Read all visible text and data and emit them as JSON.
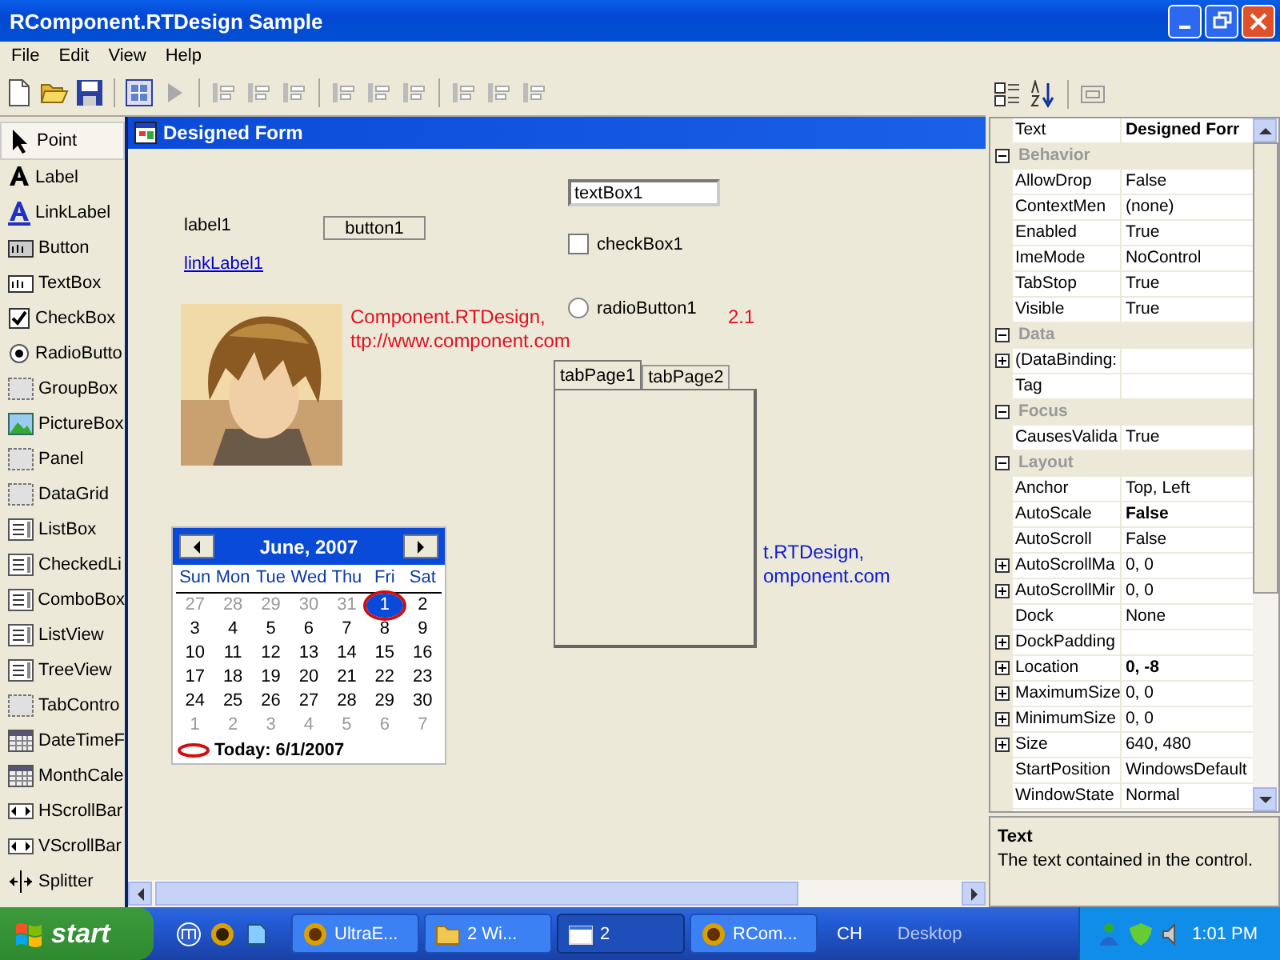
{
  "window": {
    "title": "RComponent.RTDesign Sample"
  },
  "menu": [
    "File",
    "Edit",
    "View",
    "Help"
  ],
  "toolbar": [
    {
      "kind": "new",
      "disabled": false
    },
    {
      "kind": "open",
      "disabled": false
    },
    {
      "kind": "save",
      "disabled": false
    },
    {
      "kind": "sep"
    },
    {
      "kind": "grid",
      "disabled": false
    },
    {
      "kind": "run",
      "disabled": true
    },
    {
      "kind": "sep"
    },
    {
      "kind": "align",
      "disabled": true
    },
    {
      "kind": "align",
      "disabled": true
    },
    {
      "kind": "align",
      "disabled": true
    },
    {
      "kind": "sep"
    },
    {
      "kind": "align",
      "disabled": true
    },
    {
      "kind": "align",
      "disabled": true
    },
    {
      "kind": "align",
      "disabled": true
    },
    {
      "kind": "sep"
    },
    {
      "kind": "align",
      "disabled": true
    },
    {
      "kind": "align",
      "disabled": true
    },
    {
      "kind": "align",
      "disabled": true
    }
  ],
  "toolbox": [
    {
      "label": "Point",
      "kind": "pointer",
      "selected": true
    },
    {
      "label": "Label",
      "kind": "label",
      "selected": false
    },
    {
      "label": "LinkLabel",
      "kind": "link",
      "selected": false
    },
    {
      "label": "Button",
      "kind": "button",
      "selected": false
    },
    {
      "label": "TextBox",
      "kind": "textbox",
      "selected": false
    },
    {
      "label": "CheckBox",
      "kind": "checkbox",
      "selected": false
    },
    {
      "label": "RadioButto",
      "kind": "radio",
      "selected": false
    },
    {
      "label": "GroupBox",
      "kind": "control",
      "selected": false
    },
    {
      "label": "PictureBox",
      "kind": "picture",
      "selected": false
    },
    {
      "label": "Panel",
      "kind": "control",
      "selected": false
    },
    {
      "label": "DataGrid",
      "kind": "control",
      "selected": false
    },
    {
      "label": "ListBox",
      "kind": "list",
      "selected": false
    },
    {
      "label": "CheckedLi",
      "kind": "list",
      "selected": false
    },
    {
      "label": "ComboBox",
      "kind": "list",
      "selected": false
    },
    {
      "label": "ListView",
      "kind": "list",
      "selected": false
    },
    {
      "label": "TreeView",
      "kind": "list",
      "selected": false
    },
    {
      "label": "TabContro",
      "kind": "control",
      "selected": false
    },
    {
      "label": "DateTimeF",
      "kind": "calendar",
      "selected": false
    },
    {
      "label": "MonthCale",
      "kind": "calendar",
      "selected": false
    },
    {
      "label": "HScrollBar",
      "kind": "scroll",
      "selected": false
    },
    {
      "label": "VScrollBar",
      "kind": "scroll",
      "selected": false
    },
    {
      "label": "Splitter",
      "kind": "splitter",
      "selected": false
    }
  ],
  "form": {
    "title": "Designed Form",
    "label": "label1",
    "button": "button1",
    "link": "linkLabel1",
    "textbox": {
      "value": "textBox1"
    },
    "checkbox": {
      "label": "checkBox1",
      "checked": false
    },
    "radio": {
      "label": "radioButton1",
      "checked": false
    },
    "red_text": [
      "Component.RTDesign, ",
      "2.1",
      "ttp://www.component.com"
    ],
    "blue_text": [
      "t.RTDesign,",
      "omponent.com"
    ],
    "tabs": [
      {
        "label": "tabPage1",
        "selected": true
      },
      {
        "label": "tabPage2",
        "selected": false
      }
    ],
    "calendar": {
      "month": "June, 2007",
      "days": [
        "Sun",
        "Mon",
        "Tue",
        "Wed",
        "Thu",
        "Fri",
        "Sat"
      ],
      "weeks": [
        [
          {
            "d": "27",
            "muted": true,
            "selected": false
          },
          {
            "d": "28",
            "muted": true,
            "selected": false
          },
          {
            "d": "29",
            "muted": true,
            "selected": false
          },
          {
            "d": "30",
            "muted": true,
            "selected": false
          },
          {
            "d": "31",
            "muted": true,
            "selected": false
          },
          {
            "d": "1",
            "muted": false,
            "selected": true
          },
          {
            "d": "2",
            "muted": false,
            "selected": false
          }
        ],
        [
          {
            "d": "3",
            "muted": false,
            "selected": false
          },
          {
            "d": "4",
            "muted": false,
            "selected": false
          },
          {
            "d": "5",
            "muted": false,
            "selected": false
          },
          {
            "d": "6",
            "muted": false,
            "selected": false
          },
          {
            "d": "7",
            "muted": false,
            "selected": false
          },
          {
            "d": "8",
            "muted": false,
            "selected": false
          },
          {
            "d": "9",
            "muted": false,
            "selected": false
          }
        ],
        [
          {
            "d": "10",
            "muted": false,
            "selected": false
          },
          {
            "d": "11",
            "muted": false,
            "selected": false
          },
          {
            "d": "12",
            "muted": false,
            "selected": false
          },
          {
            "d": "13",
            "muted": false,
            "selected": false
          },
          {
            "d": "14",
            "muted": false,
            "selected": false
          },
          {
            "d": "15",
            "muted": false,
            "selected": false
          },
          {
            "d": "16",
            "muted": false,
            "selected": false
          }
        ],
        [
          {
            "d": "17",
            "muted": false,
            "selected": false
          },
          {
            "d": "18",
            "muted": false,
            "selected": false
          },
          {
            "d": "19",
            "muted": false,
            "selected": false
          },
          {
            "d": "20",
            "muted": false,
            "selected": false
          },
          {
            "d": "21",
            "muted": false,
            "selected": false
          },
          {
            "d": "22",
            "muted": false,
            "selected": false
          },
          {
            "d": "23",
            "muted": false,
            "selected": false
          }
        ],
        [
          {
            "d": "24",
            "muted": false,
            "selected": false
          },
          {
            "d": "25",
            "muted": false,
            "selected": false
          },
          {
            "d": "26",
            "muted": false,
            "selected": false
          },
          {
            "d": "27",
            "muted": false,
            "selected": false
          },
          {
            "d": "28",
            "muted": false,
            "selected": false
          },
          {
            "d": "29",
            "muted": false,
            "selected": false
          },
          {
            "d": "30",
            "muted": false,
            "selected": false
          }
        ],
        [
          {
            "d": "1",
            "muted": true,
            "selected": false
          },
          {
            "d": "2",
            "muted": true,
            "selected": false
          },
          {
            "d": "3",
            "muted": true,
            "selected": false
          },
          {
            "d": "4",
            "muted": true,
            "selected": false
          },
          {
            "d": "5",
            "muted": true,
            "selected": false
          },
          {
            "d": "6",
            "muted": true,
            "selected": false
          },
          {
            "d": "7",
            "muted": true,
            "selected": false
          }
        ]
      ],
      "today": "Today: 6/1/2007"
    }
  },
  "properties": {
    "top": {
      "name": "Text",
      "value": "Designed Forr"
    },
    "categories": [
      {
        "name": "Behavior",
        "expanded": true,
        "rows": [
          {
            "name": "AllowDrop",
            "value": "False",
            "expandable": false
          },
          {
            "name": "ContextMen",
            "value": "(none)",
            "expandable": false
          },
          {
            "name": "Enabled",
            "value": "True",
            "expandable": false
          },
          {
            "name": "ImeMode",
            "value": "NoControl",
            "expandable": false
          },
          {
            "name": "TabStop",
            "value": "True",
            "expandable": false
          },
          {
            "name": "Visible",
            "value": "True",
            "expandable": false
          }
        ]
      },
      {
        "name": "Data",
        "expanded": true,
        "rows": [
          {
            "name": "(DataBinding:",
            "value": "",
            "expandable": true
          },
          {
            "name": "Tag",
            "value": "",
            "expandable": false
          }
        ]
      },
      {
        "name": "Focus",
        "expanded": true,
        "rows": [
          {
            "name": "CausesValida",
            "value": "True",
            "expandable": false
          }
        ]
      },
      {
        "name": "Layout",
        "expanded": true,
        "rows": [
          {
            "name": "Anchor",
            "value": "Top, Left",
            "expandable": false
          },
          {
            "name": "AutoScale",
            "value": "False",
            "bold": true,
            "expandable": false
          },
          {
            "name": "AutoScroll",
            "value": "False",
            "expandable": false
          },
          {
            "name": "AutoScrollMa",
            "value": "0, 0",
            "expandable": true
          },
          {
            "name": "AutoScrollMir",
            "value": "0, 0",
            "expandable": true
          },
          {
            "name": "Dock",
            "value": "None",
            "expandable": false
          },
          {
            "name": "DockPadding",
            "value": "",
            "expandable": true
          },
          {
            "name": "Location",
            "value": "0, -8",
            "bold": true,
            "expandable": true
          },
          {
            "name": "MaximumSize",
            "value": "0, 0",
            "expandable": true
          },
          {
            "name": "MinimumSize",
            "value": "0, 0",
            "expandable": true
          },
          {
            "name": "Size",
            "value": "640, 480",
            "expandable": true
          },
          {
            "name": "StartPosition",
            "value": "WindowsDefault",
            "expandable": false
          },
          {
            "name": "WindowState",
            "value": "Normal",
            "expandable": false
          }
        ]
      }
    ],
    "description": {
      "title": "Text",
      "text": "The text contained in the control."
    }
  },
  "taskbar": {
    "start": "start",
    "tasks": [
      {
        "label": "UltraE...",
        "kind": "app",
        "selected": false
      },
      {
        "label": "2 Wi...",
        "kind": "folder",
        "selected": false
      },
      {
        "label": "2",
        "kind": "window",
        "selected": true
      },
      {
        "label": "RCom...",
        "kind": "app",
        "selected": false
      }
    ],
    "language": "CH",
    "desktop": "Desktop",
    "clock": "1:01 PM"
  }
}
